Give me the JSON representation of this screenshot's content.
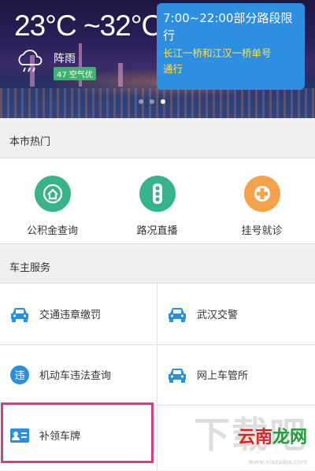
{
  "weather": {
    "temperature": "23°C ~32°C",
    "description": "阵雨",
    "aqi": "47 空气优"
  },
  "notice": {
    "title": "7:00~22:00部分路段限行",
    "detail_line1": "长江一桥和江汉一桥单号",
    "detail_line2": "通行"
  },
  "hot": {
    "header": "本市热门",
    "items": [
      {
        "label": "公积金查询",
        "color": "#3bb38a",
        "icon": "housing-fund-icon"
      },
      {
        "label": "路况直播",
        "color": "#34b38d",
        "icon": "traffic-light-icon"
      },
      {
        "label": "挂号就诊",
        "color": "#f5a24a",
        "icon": "medical-cross-icon"
      }
    ]
  },
  "services": {
    "header": "车主服务",
    "items": [
      {
        "label": "交通违章缴罚",
        "icon": "car-icon"
      },
      {
        "label": "武汉交警",
        "icon": "car-icon"
      },
      {
        "label": "机动车违法查询",
        "icon": "violation-icon"
      },
      {
        "label": "网上车管所",
        "icon": "car-icon"
      },
      {
        "label": "补领车牌",
        "icon": "id-card-icon"
      }
    ]
  },
  "watermark": {
    "big": "下载吧",
    "brand_a": "云南",
    "brand_b": "龙网",
    "url": "www.xiazaiba.com"
  },
  "colors": {
    "accent_blue": "#2e8fe0",
    "icon_blue": "#2b8fdd",
    "highlight": "#d83a83"
  }
}
